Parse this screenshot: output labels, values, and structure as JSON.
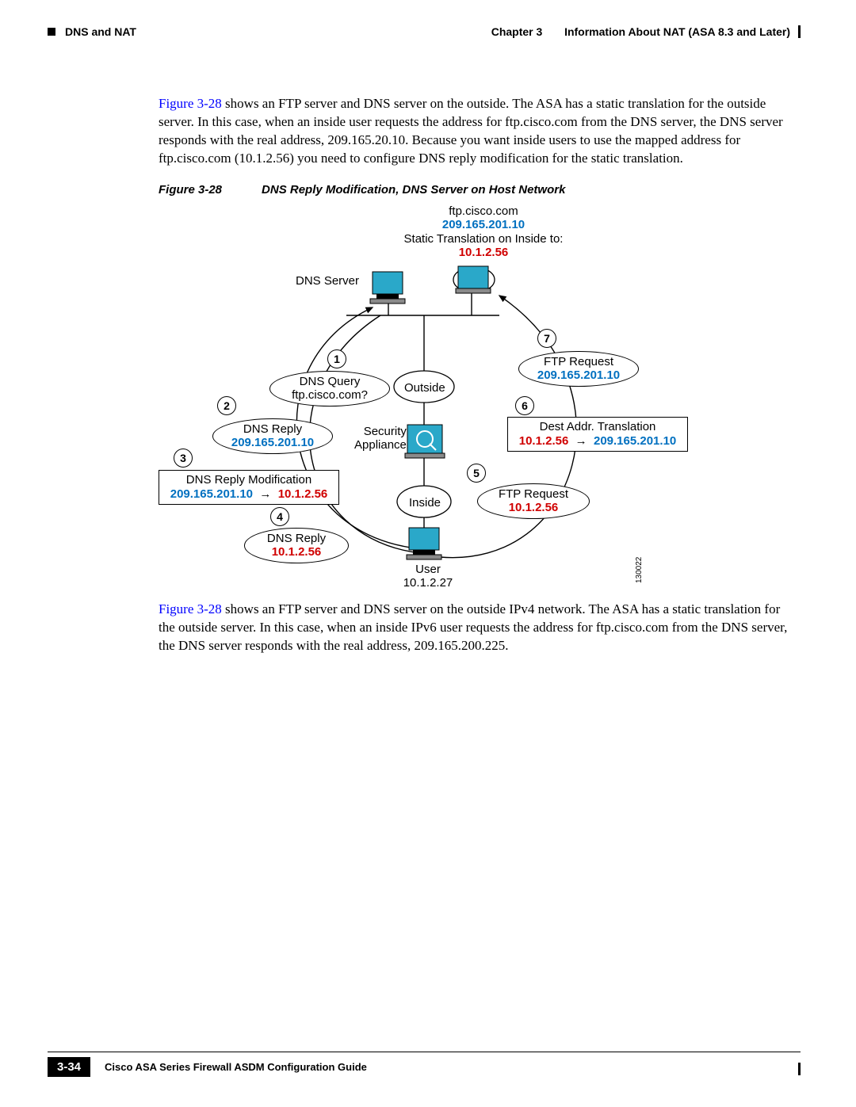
{
  "header": {
    "section": "DNS and NAT",
    "chapter": "Chapter 3",
    "title": "Information About NAT (ASA 8.3 and Later)"
  },
  "para1": {
    "link": "Figure 3-28",
    "text": " shows an FTP server and DNS server on the outside. The ASA has a static translation for the outside server. In this case, when an inside user requests the address for ftp.cisco.com from the DNS server, the DNS server responds with the real address, 209.165.20.10. Because you want inside users to use the mapped address for ftp.cisco.com (10.1.2.56) you need to configure DNS reply modification for the static translation."
  },
  "figcap": {
    "num": "Figure 3-28",
    "title": "DNS Reply Modification, DNS Server on Host Network"
  },
  "diagram": {
    "top": {
      "host": "ftp.cisco.com",
      "ip": "209.165.201.10",
      "trans": "Static Translation on Inside to:",
      "transip": "10.1.2.56"
    },
    "dns_server": "DNS Server",
    "outside": "Outside",
    "security": "Security\nAppliance",
    "inside": "Inside",
    "user": "User",
    "user_ip": "10.1.2.27",
    "step1": {
      "l1": "DNS Query",
      "l2": "ftp.cisco.com?"
    },
    "step2": {
      "l1": "DNS Reply",
      "l2": "209.165.201.10"
    },
    "step3": {
      "l1": "DNS Reply Modification",
      "l2a": "209.165.201.10",
      "l2b": "10.1.2.56"
    },
    "step4": {
      "l1": "DNS Reply",
      "l2": "10.1.2.56"
    },
    "step5": {
      "l1": "FTP Request",
      "l2": "10.1.2.56"
    },
    "step6": {
      "l1": "Dest Addr. Translation",
      "l2a": "10.1.2.56",
      "l2b": "209.165.201.10"
    },
    "step7": {
      "l1": "FTP Request",
      "l2": "209.165.201.10"
    },
    "imgid": "130022"
  },
  "para2": {
    "link": "Figure 3-28",
    "text": " shows an FTP server and DNS server on the outside IPv4 network. The ASA has a static translation for the outside server. In this case, when an inside IPv6 user requests the address for ftp.cisco.com from the DNS server, the DNS server responds with the real address, 209.165.200.225."
  },
  "footer": {
    "guide": "Cisco ASA Series Firewall ASDM Configuration Guide",
    "page": "3-34"
  }
}
